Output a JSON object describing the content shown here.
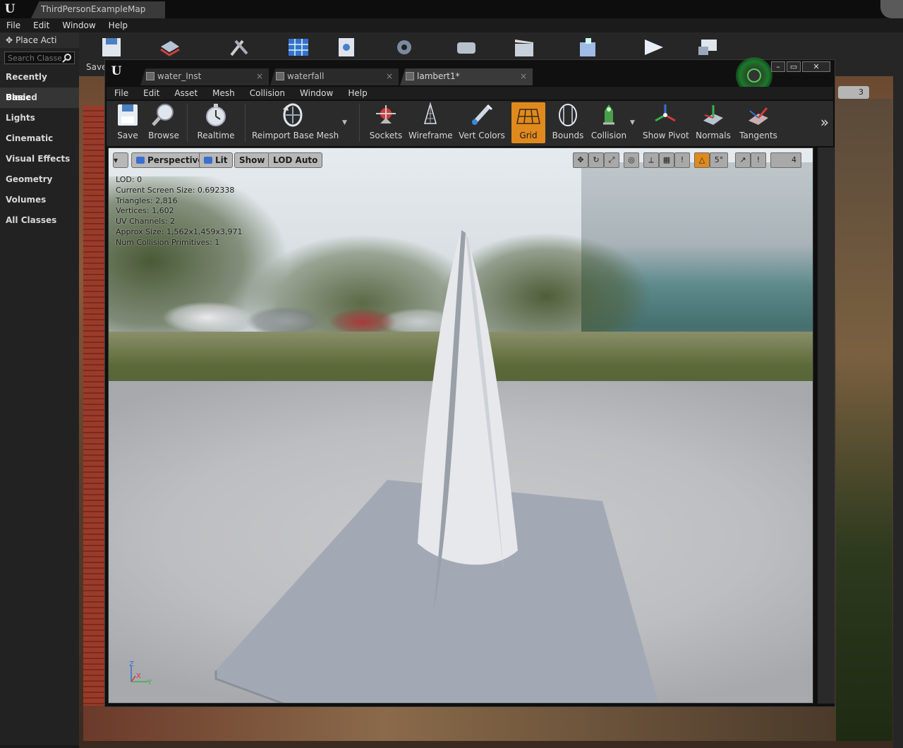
{
  "main": {
    "tab_title": "ThirdPersonExampleMap",
    "menu": [
      "File",
      "Edit",
      "Window",
      "Help"
    ],
    "toolbar_save_label": "Save",
    "place_actors_label": "Place Acti",
    "search_placeholder": "Search Classe",
    "categories": [
      "Recently Placed",
      "Basic",
      "Lights",
      "Cinematic",
      "Visual Effects",
      "Geometry",
      "Volumes",
      "All Classes"
    ],
    "viewport_badge": "3"
  },
  "editor": {
    "tabs": [
      {
        "label": "water_Inst"
      },
      {
        "label": "waterfall"
      },
      {
        "label": "lambert1*"
      }
    ],
    "menu": [
      "File",
      "Edit",
      "Asset",
      "Mesh",
      "Collision",
      "Window",
      "Help"
    ],
    "tools": [
      {
        "label": "Save",
        "icon": "save-icon"
      },
      {
        "label": "Browse",
        "icon": "browse-icon"
      },
      {
        "label": "Realtime",
        "icon": "realtime-icon"
      },
      {
        "label": "Reimport Base Mesh",
        "icon": "reimport-icon"
      },
      {
        "label": "Sockets",
        "icon": "sockets-icon"
      },
      {
        "label": "Wireframe",
        "icon": "wireframe-icon"
      },
      {
        "label": "Vert Colors",
        "icon": "vert-colors-icon"
      },
      {
        "label": "Grid",
        "icon": "grid-icon"
      },
      {
        "label": "Bounds",
        "icon": "bounds-icon"
      },
      {
        "label": "Collision",
        "icon": "collision-icon"
      },
      {
        "label": "Show Pivot",
        "icon": "show-pivot-icon"
      },
      {
        "label": "Normals",
        "icon": "normals-icon"
      },
      {
        "label": "Tangents",
        "icon": "tangents-icon"
      }
    ],
    "active_tool": "Grid",
    "viewport": {
      "perspective_label": "Perspective",
      "lit_label": "Lit",
      "show_label": "Show",
      "lod_label": "LOD Auto",
      "snap_angle": "5°",
      "camera_speed": "4",
      "stats": [
        "LOD:  0",
        "Current Screen Size:  0.692338",
        "Triangles:  2,816",
        "Vertices:  1,602",
        "UV Channels:  2",
        "Approx Size: 1,562x1,459x3,971",
        "Num Collision Primitives:  1"
      ],
      "axis": {
        "z": "Z",
        "x": "X",
        "y": "Y"
      }
    }
  },
  "colors": {
    "accent_orange": "#e08a1e",
    "panel_dark": "#222222",
    "toolbar": "#2b2b2b"
  }
}
